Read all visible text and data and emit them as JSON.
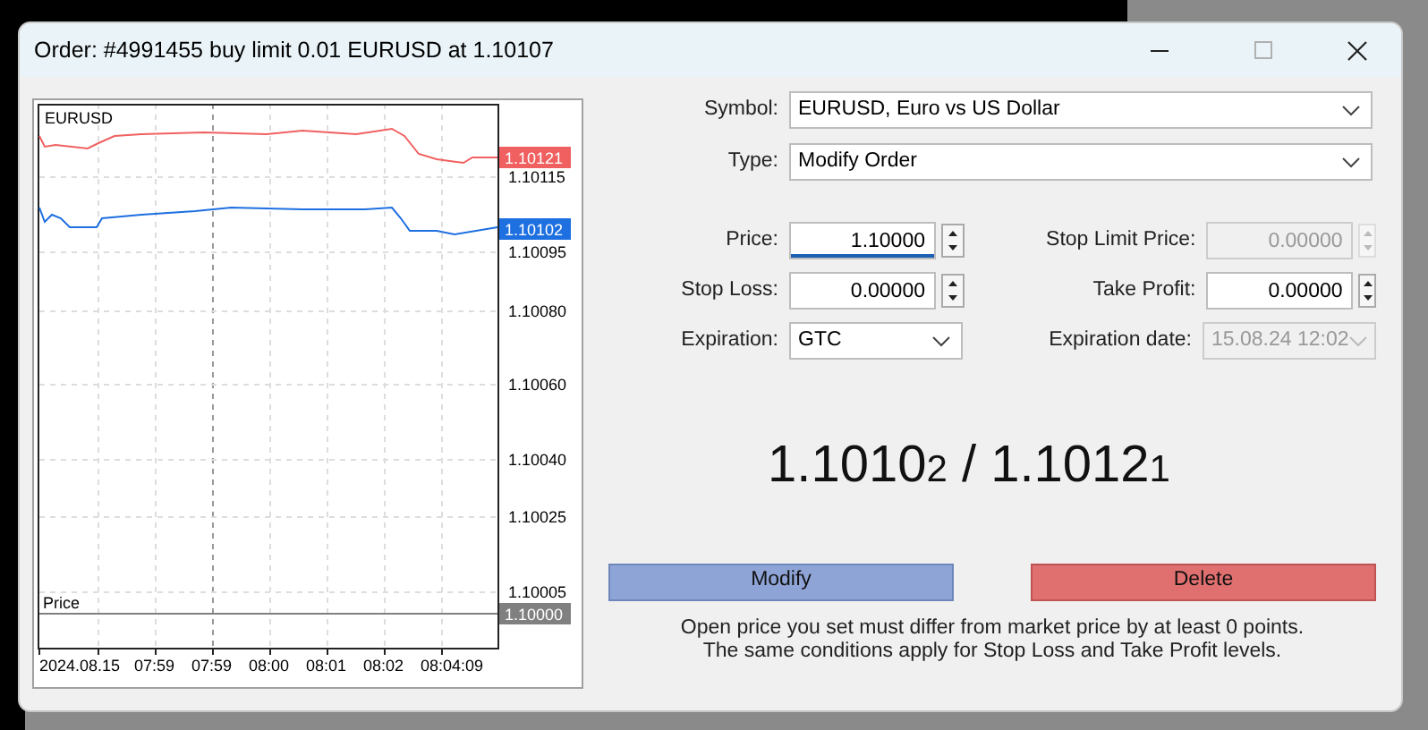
{
  "window": {
    "title": "Order: #4991455 buy limit 0.01 EURUSD at 1.10107"
  },
  "chart": {
    "symbol": "EURUSD",
    "y_labels": [
      "1.10115",
      "1.10095",
      "1.10080",
      "1.10060",
      "1.10040",
      "1.10025",
      "1.10005"
    ],
    "price_tags": [
      {
        "text": "1.10121",
        "color": "#f06060"
      },
      {
        "text": "1.10102",
        "color": "#1e6fe0"
      },
      {
        "text": "1.10000",
        "color": "#808080"
      }
    ],
    "price_line_label": "Price",
    "x_labels": [
      "2024.08.15",
      "07:59",
      "07:59",
      "08:00",
      "08:01",
      "08:02",
      "08:04:09"
    ]
  },
  "form": {
    "symbol": {
      "label": "Symbol:",
      "value": "EURUSD, Euro vs US Dollar"
    },
    "type": {
      "label": "Type:",
      "value": "Modify Order"
    },
    "fields": [
      {
        "label": "Price:",
        "value": "1.10000",
        "disabled": false,
        "kind": "spin",
        "focused": true
      },
      {
        "label": "Stop Limit Price:",
        "value": "0.00000",
        "disabled": true,
        "kind": "spin",
        "focused": false
      },
      {
        "label": "Stop Loss:",
        "value": "0.00000",
        "disabled": false,
        "kind": "spin",
        "focused": false
      },
      {
        "label": "Take Profit:",
        "value": "0.00000",
        "disabled": false,
        "kind": "spin",
        "focused": false
      },
      {
        "label": "Expiration:",
        "value": "GTC",
        "disabled": false,
        "kind": "select"
      },
      {
        "label": "Expiration date:",
        "value": "15.08.24 12:02",
        "disabled": true,
        "kind": "select"
      }
    ]
  },
  "quote": {
    "bid": "1.1010",
    "bid_last": "2",
    "separator": "/",
    "ask": "1.1012",
    "ask_last": "1"
  },
  "buttons": [
    {
      "label": "Modify",
      "kind": "modify"
    },
    {
      "label": "Delete",
      "kind": "delete"
    }
  ],
  "note": [
    "Open price you set must differ from market price by at least 0 points.",
    "The same conditions apply for Stop Loss and Take Profit levels."
  ]
}
